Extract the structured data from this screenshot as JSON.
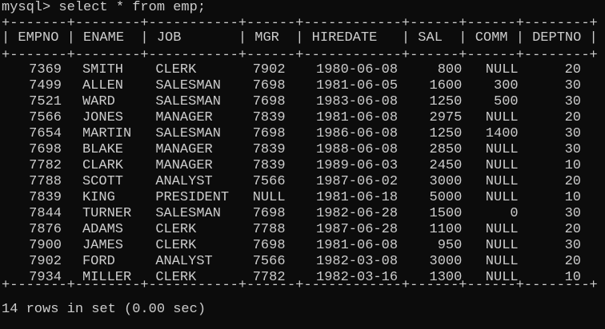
{
  "terminal": {
    "command": "mysql> select * from emp;",
    "separator": "+-------+--------+-----------+------+------------+------+------+--------+",
    "header_line": "| EMPNO | ENAME  | JOB       | MGR  | HIREDATE   | SAL  | COMM | DEPTNO |",
    "columns": [
      "EMPNO",
      "ENAME",
      "JOB",
      "MGR",
      "HIREDATE",
      "SAL",
      "COMM",
      "DEPTNO"
    ],
    "rows": [
      {
        "empno": "7369",
        "ename": "SMITH",
        "job": "CLERK",
        "mgr": "7902",
        "hiredate": "1980-06-08",
        "sal": "800",
        "comm": "NULL",
        "deptno": "20"
      },
      {
        "empno": "7499",
        "ename": "ALLEN",
        "job": "SALESMAN",
        "mgr": "7698",
        "hiredate": "1981-06-05",
        "sal": "1600",
        "comm": "300",
        "deptno": "30"
      },
      {
        "empno": "7521",
        "ename": "WARD",
        "job": "SALESMAN",
        "mgr": "7698",
        "hiredate": "1983-06-08",
        "sal": "1250",
        "comm": "500",
        "deptno": "30"
      },
      {
        "empno": "7566",
        "ename": "JONES",
        "job": "MANAGER",
        "mgr": "7839",
        "hiredate": "1981-06-08",
        "sal": "2975",
        "comm": "NULL",
        "deptno": "20"
      },
      {
        "empno": "7654",
        "ename": "MARTIN",
        "job": "SALESMAN",
        "mgr": "7698",
        "hiredate": "1986-06-08",
        "sal": "1250",
        "comm": "1400",
        "deptno": "30"
      },
      {
        "empno": "7698",
        "ename": "BLAKE",
        "job": "MANAGER",
        "mgr": "7839",
        "hiredate": "1988-06-08",
        "sal": "2850",
        "comm": "NULL",
        "deptno": "30"
      },
      {
        "empno": "7782",
        "ename": "CLARK",
        "job": "MANAGER",
        "mgr": "7839",
        "hiredate": "1989-06-03",
        "sal": "2450",
        "comm": "NULL",
        "deptno": "10"
      },
      {
        "empno": "7788",
        "ename": "SCOTT",
        "job": "ANALYST",
        "mgr": "7566",
        "hiredate": "1987-06-02",
        "sal": "3000",
        "comm": "NULL",
        "deptno": "20"
      },
      {
        "empno": "7839",
        "ename": "KING",
        "job": "PRESIDENT",
        "mgr": "NULL",
        "hiredate": "1981-06-18",
        "sal": "5000",
        "comm": "NULL",
        "deptno": "10"
      },
      {
        "empno": "7844",
        "ename": "TURNER",
        "job": "SALESMAN",
        "mgr": "7698",
        "hiredate": "1982-06-28",
        "sal": "1500",
        "comm": "0",
        "deptno": "30"
      },
      {
        "empno": "7876",
        "ename": "ADAMS",
        "job": "CLERK",
        "mgr": "7788",
        "hiredate": "1987-06-28",
        "sal": "1100",
        "comm": "NULL",
        "deptno": "20"
      },
      {
        "empno": "7900",
        "ename": "JAMES",
        "job": "CLERK",
        "mgr": "7698",
        "hiredate": "1981-06-08",
        "sal": "950",
        "comm": "NULL",
        "deptno": "30"
      },
      {
        "empno": "7902",
        "ename": "FORD",
        "job": "ANALYST",
        "mgr": "7566",
        "hiredate": "1982-03-08",
        "sal": "3000",
        "comm": "NULL",
        "deptno": "20"
      },
      {
        "empno": "7934",
        "ename": "MILLER",
        "job": "CLERK",
        "mgr": "7782",
        "hiredate": "1982-03-16",
        "sal": "1300",
        "comm": "NULL",
        "deptno": "10"
      }
    ],
    "result_line": "14 rows in set (0.00 sec)",
    "colors": {
      "background": "#0c0c0c",
      "text": "#cccccc"
    }
  }
}
